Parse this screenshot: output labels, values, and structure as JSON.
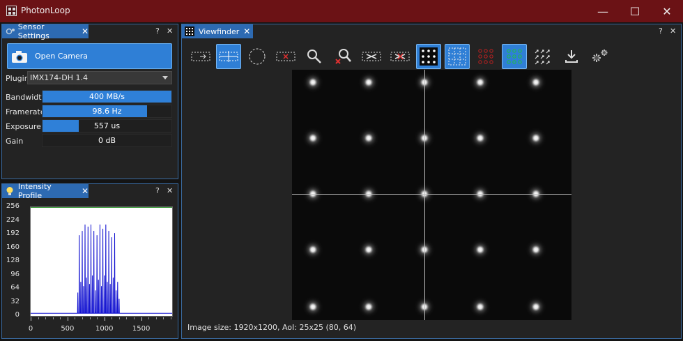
{
  "app": {
    "title": "PhotonLoop"
  },
  "window_controls": {
    "minimize": "—",
    "maximize": "☐",
    "close": "✕"
  },
  "sensor_panel": {
    "tab_label": "Sensor Settings",
    "open_camera_label": "Open Camera",
    "plugin_label": "Plugin",
    "plugin_value": "IMX174-DH 1.4",
    "params": [
      {
        "label": "Bandwidth",
        "value": "400 MB/s",
        "fill": 1.0
      },
      {
        "label": "Framerate",
        "value": "98.6 Hz",
        "fill": 0.81
      },
      {
        "label": "Exposure",
        "value": "557 us",
        "fill": 0.28
      },
      {
        "label": "Gain",
        "value": "0 dB",
        "fill": 0.0
      }
    ]
  },
  "intensity_panel": {
    "tab_label": "Intensity Profile"
  },
  "viewfinder_panel": {
    "tab_label": "Viewfinder",
    "status": "Image size: 1920x1200, AoI: 25x25 (80, 64)"
  },
  "dock": {
    "help": "?",
    "close": "✕",
    "tab_close": "✕"
  },
  "toolbar": [
    {
      "name": "aoi-select-icon",
      "active": false
    },
    {
      "name": "crosshair-icon",
      "active": true
    },
    {
      "name": "circle-select-icon",
      "active": false
    },
    {
      "name": "remove-aoi-icon",
      "active": false
    },
    {
      "name": "zoom-icon",
      "active": false
    },
    {
      "name": "zoom-reset-icon",
      "active": false
    },
    {
      "name": "cut-icon",
      "active": false
    },
    {
      "name": "cut-remove-icon",
      "active": false
    },
    {
      "name": "spot-grid-icon",
      "active": true
    },
    {
      "name": "grid-overlay-icon",
      "active": true
    },
    {
      "name": "red-dots-icon",
      "active": false
    },
    {
      "name": "green-dots-icon",
      "active": true
    },
    {
      "name": "arrows-grid-icon",
      "active": false
    },
    {
      "name": "download-icon",
      "active": false
    },
    {
      "name": "settings-gears-icon",
      "active": false
    }
  ],
  "chart_data": {
    "type": "line",
    "title": "",
    "xlabel": "",
    "ylabel": "",
    "xlim": [
      0,
      1920
    ],
    "ylim": [
      0,
      256
    ],
    "x_ticks": [
      0,
      500,
      1000,
      1500
    ],
    "y_ticks": [
      0,
      32,
      64,
      96,
      128,
      160,
      192,
      224,
      256
    ],
    "x_tick_labels": [
      "0",
      "500",
      "1000",
      "1500"
    ],
    "y_tick_labels": [
      "0",
      "32",
      "64",
      "96",
      "128",
      "160",
      "192",
      "224",
      "256"
    ],
    "line_color": "#1010d0",
    "baseline": 6,
    "peaks": [
      {
        "x": 640,
        "y": 55
      },
      {
        "x": 660,
        "y": 190
      },
      {
        "x": 680,
        "y": 80
      },
      {
        "x": 700,
        "y": 200
      },
      {
        "x": 718,
        "y": 70
      },
      {
        "x": 738,
        "y": 215
      },
      {
        "x": 758,
        "y": 90
      },
      {
        "x": 778,
        "y": 210
      },
      {
        "x": 798,
        "y": 75
      },
      {
        "x": 818,
        "y": 215
      },
      {
        "x": 838,
        "y": 95
      },
      {
        "x": 858,
        "y": 200
      },
      {
        "x": 880,
        "y": 60
      },
      {
        "x": 900,
        "y": 190
      },
      {
        "x": 920,
        "y": 85
      },
      {
        "x": 940,
        "y": 215
      },
      {
        "x": 960,
        "y": 70
      },
      {
        "x": 980,
        "y": 205
      },
      {
        "x": 1000,
        "y": 95
      },
      {
        "x": 1020,
        "y": 215
      },
      {
        "x": 1040,
        "y": 80
      },
      {
        "x": 1060,
        "y": 200
      },
      {
        "x": 1080,
        "y": 75
      },
      {
        "x": 1100,
        "y": 185
      },
      {
        "x": 1120,
        "y": 90
      },
      {
        "x": 1140,
        "y": 195
      },
      {
        "x": 1160,
        "y": 60
      },
      {
        "x": 1180,
        "y": 80
      },
      {
        "x": 1200,
        "y": 40
      }
    ]
  }
}
